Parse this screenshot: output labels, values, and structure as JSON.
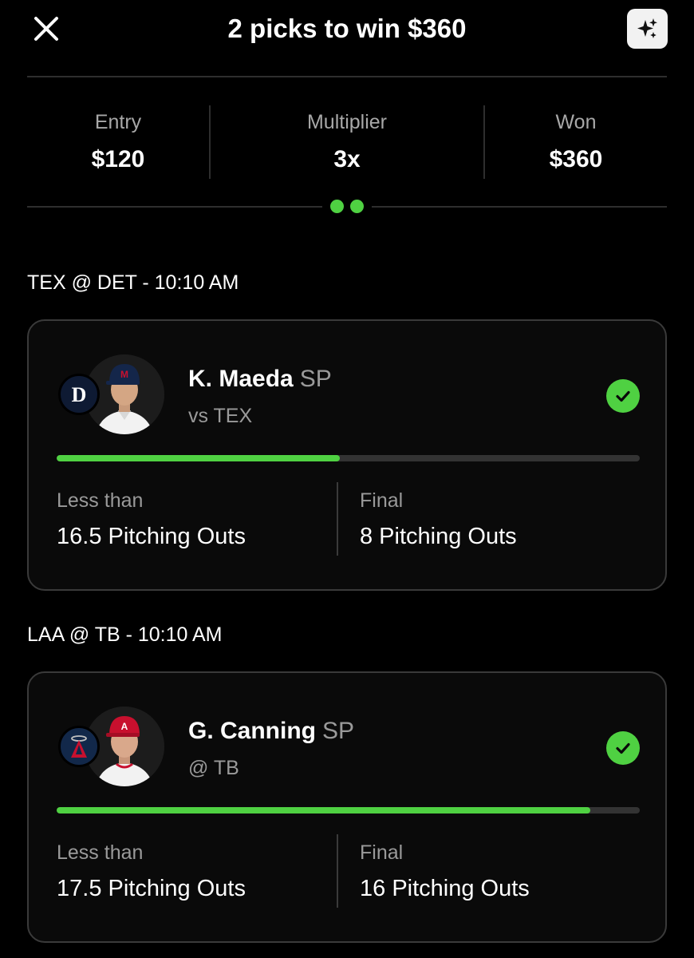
{
  "header": {
    "title": "2 picks to win $360"
  },
  "summary": {
    "entry_label": "Entry",
    "entry_value": "$120",
    "multiplier_label": "Multiplier",
    "multiplier_value": "3x",
    "won_label": "Won",
    "won_value": "$360"
  },
  "pager": {
    "pages": 2,
    "active": 0
  },
  "colors": {
    "accent": "#4fd142",
    "background": "#000000",
    "muted": "#9a9a9a"
  },
  "picks": [
    {
      "game": "TEX @ DET - 10:10 AM",
      "player": "K. Maeda",
      "position": "SP",
      "opponent": "vs TEX",
      "team_logo": "tigers-logo",
      "status": "won",
      "progress": 0.485,
      "line_label": "Less than",
      "line_value": "16.5 Pitching Outs",
      "final_label": "Final",
      "final_value": "8 Pitching Outs"
    },
    {
      "game": "LAA @ TB - 10:10 AM",
      "player": "G. Canning",
      "position": "SP",
      "opponent": "@ TB",
      "team_logo": "angels-logo",
      "status": "won",
      "progress": 0.915,
      "line_label": "Less than",
      "line_value": "17.5 Pitching Outs",
      "final_label": "Final",
      "final_value": "16 Pitching Outs"
    }
  ]
}
